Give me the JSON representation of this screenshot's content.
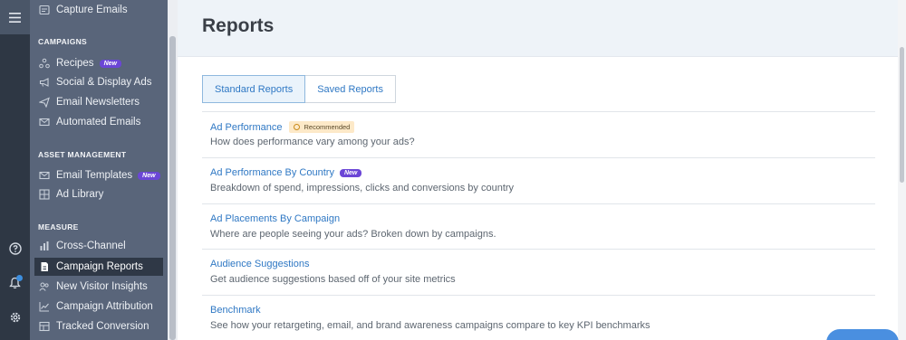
{
  "sidebar": {
    "top_item": "Capture Emails",
    "sections": [
      {
        "heading": "CAMPAIGNS",
        "items": [
          {
            "label": "Recipes",
            "badge": "New",
            "icon": "recipes-icon"
          },
          {
            "label": "Social & Display Ads",
            "icon": "megaphone-icon"
          },
          {
            "label": "Email Newsletters",
            "icon": "paper-plane-icon"
          },
          {
            "label": "Automated Emails",
            "icon": "envelope-icon"
          }
        ]
      },
      {
        "heading": "ASSET MANAGEMENT",
        "items": [
          {
            "label": "Email Templates",
            "badge": "New",
            "icon": "envelope-icon"
          },
          {
            "label": "Ad Library",
            "icon": "grid-icon"
          }
        ]
      },
      {
        "heading": "MEASURE",
        "items": [
          {
            "label": "Cross-Channel",
            "icon": "bar-chart-icon"
          },
          {
            "label": "Campaign Reports",
            "icon": "report-icon",
            "active": true
          },
          {
            "label": "New Visitor Insights",
            "icon": "users-icon"
          },
          {
            "label": "Campaign Attribution",
            "icon": "line-chart-icon"
          },
          {
            "label": "Tracked Conversion",
            "icon": "table-icon"
          }
        ]
      }
    ]
  },
  "rail": {
    "icons": [
      "hamburger-menu-icon",
      "help-icon",
      "bell-icon",
      "settings-icon"
    ]
  },
  "main": {
    "title": "Reports",
    "tabs": [
      {
        "label": "Standard Reports",
        "active": true
      },
      {
        "label": "Saved Reports",
        "active": false
      }
    ],
    "reports": [
      {
        "title": "Ad Performance",
        "description": "How does performance vary among your ads?",
        "badge": "Recommended"
      },
      {
        "title": "Ad Performance By Country",
        "description": "Breakdown of spend, impressions, clicks and conversions by country",
        "badge": "New"
      },
      {
        "title": "Ad Placements By Campaign",
        "description": "Where are people seeing your ads? Broken down by campaigns."
      },
      {
        "title": "Audience Suggestions",
        "description": "Get audience suggestions based off of your site metrics"
      },
      {
        "title": "Benchmark",
        "description": "See how your retargeting, email, and brand awareness campaigns compare to key KPI benchmarks"
      }
    ]
  },
  "colors": {
    "rail": "#2e3744",
    "sidebar": "#59657a",
    "active_item": "#2f3846",
    "link": "#2f78c4",
    "new_badge": "#6b46d6",
    "recommended_badge": "#fde9c8",
    "header_bg": "#eef3f8"
  }
}
